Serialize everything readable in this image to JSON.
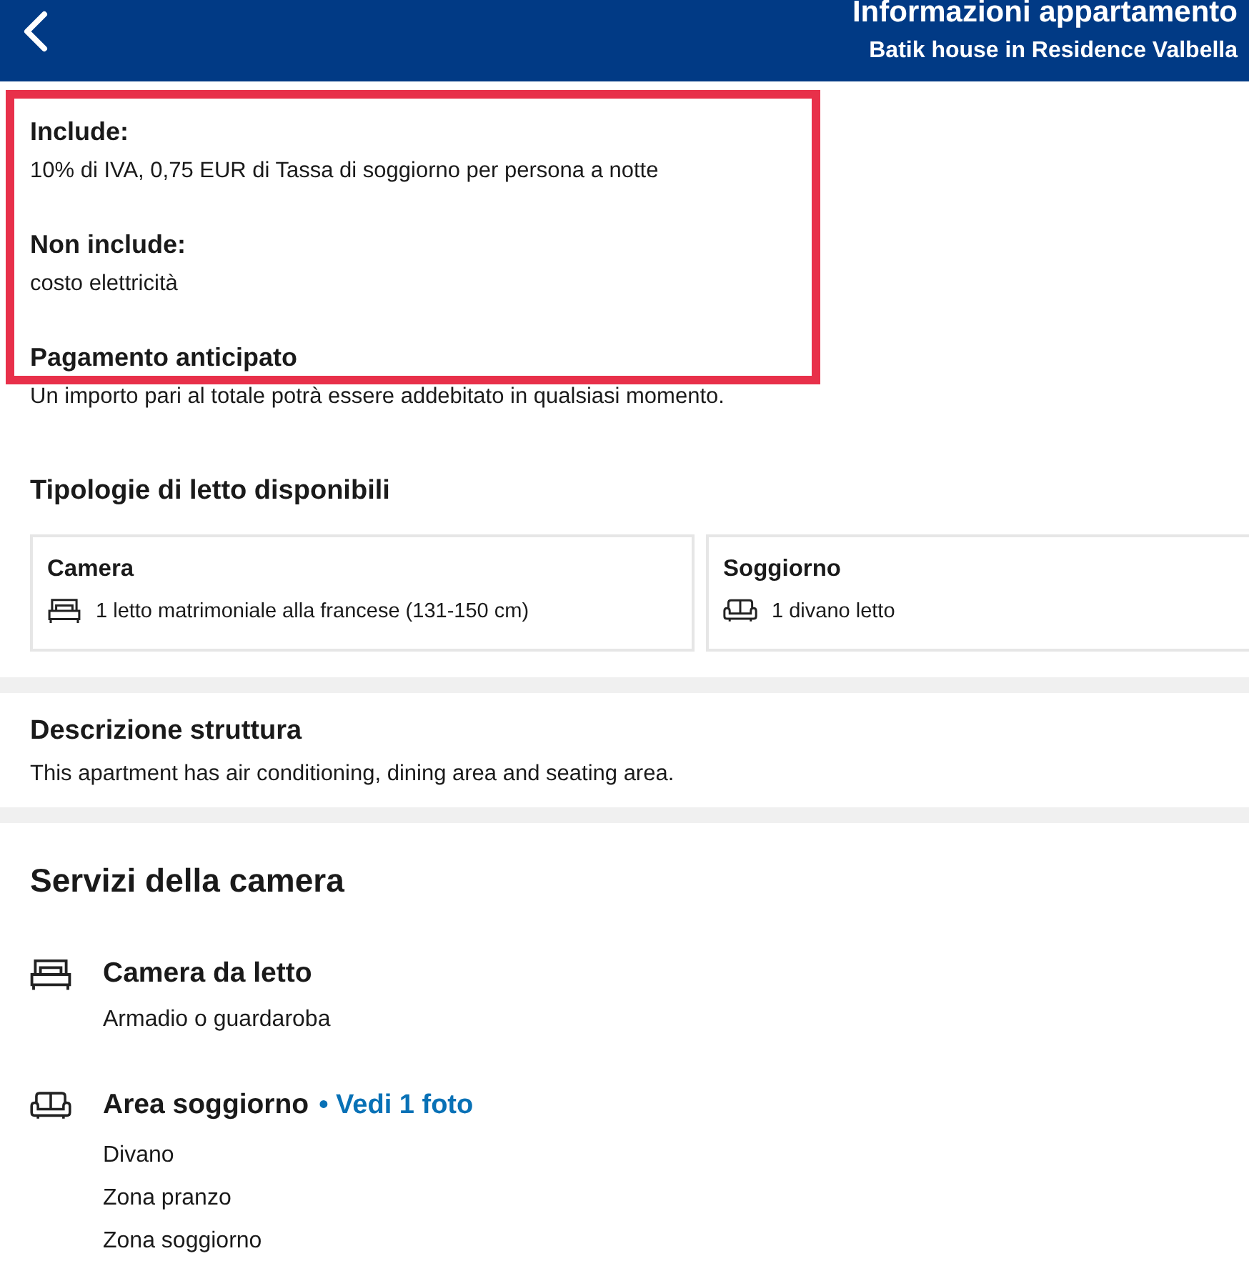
{
  "header": {
    "title": "Informazioni appartamento",
    "subtitle": "Batik house in Residence Valbella"
  },
  "policies": [
    {
      "title": "Include:",
      "text": "10% di IVA, 0,75 EUR di Tassa di soggiorno per persona a notte"
    },
    {
      "title": "Non include:",
      "text": "costo elettricità"
    },
    {
      "title": "Pagamento anticipato",
      "text": "Un importo pari al totale potrà essere addebitato in qualsiasi momento."
    }
  ],
  "highlight": {
    "shown": true
  },
  "beds": {
    "title": "Tipologie di letto disponibili",
    "rooms": [
      {
        "name": "Camera",
        "kind": "bed",
        "text": "1 letto matrimoniale alla francese (131-150 cm)"
      },
      {
        "name": "Soggiorno",
        "kind": "sofa",
        "text": "1 divano letto"
      }
    ]
  },
  "description": {
    "title": "Descrizione struttura",
    "text": "This apartment has air conditioning, dining area and seating area."
  },
  "services": {
    "title": "Servizi della camera",
    "groups": [
      {
        "kind": "bed",
        "title": "Camera da letto",
        "items": [
          "Armadio o guardaroba"
        ]
      },
      {
        "kind": "sofa",
        "title": "Area soggiorno",
        "link": "• Vedi 1 foto",
        "items": [
          "Divano",
          "Zona pranzo",
          "Zona soggiorno"
        ]
      }
    ]
  }
}
